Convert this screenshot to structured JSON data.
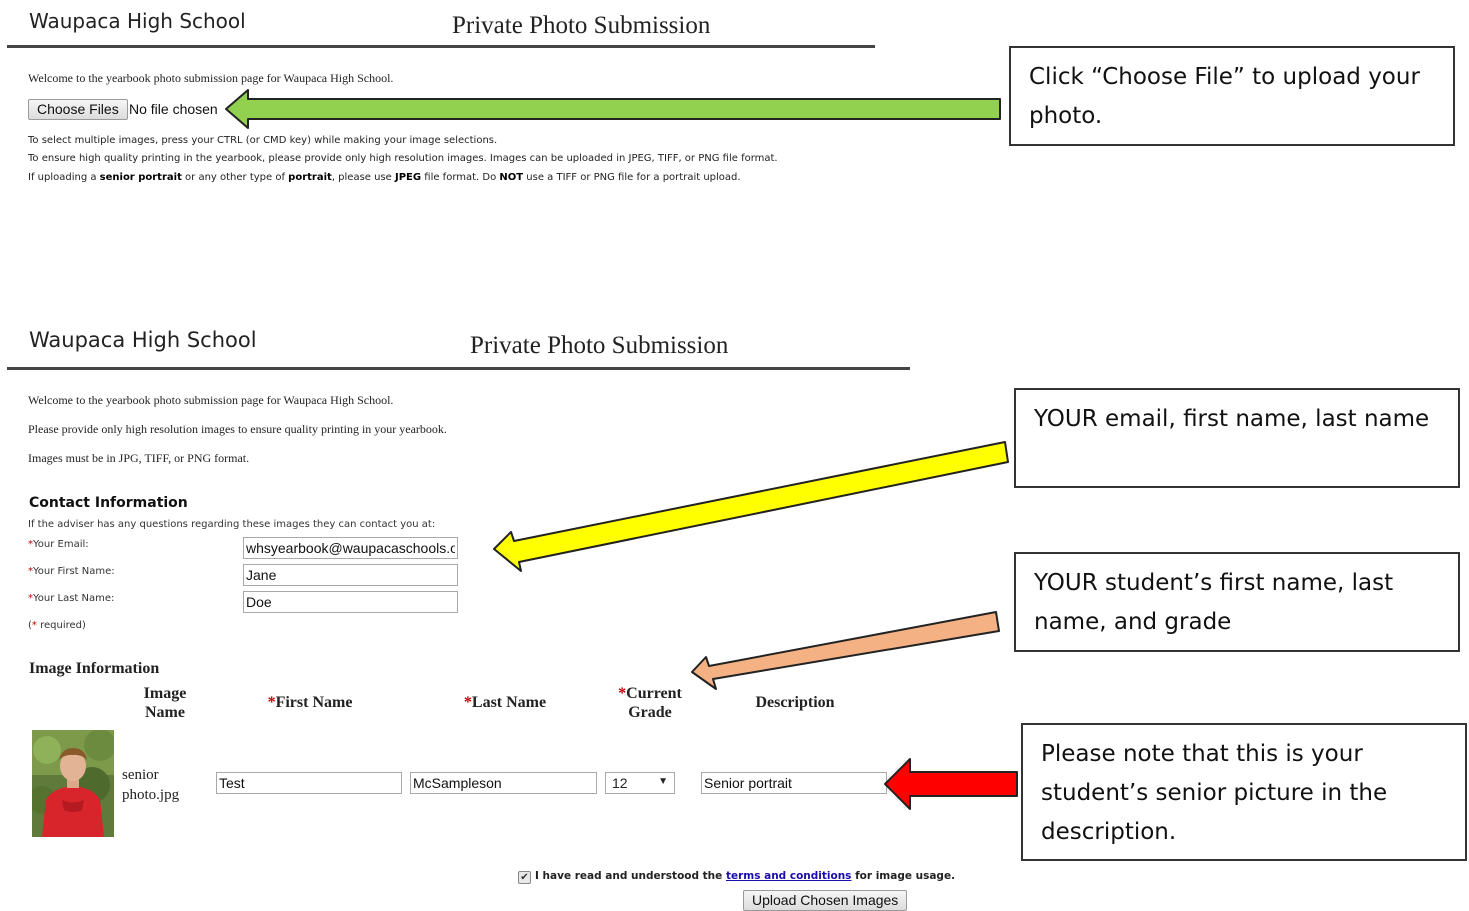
{
  "panel1": {
    "school": "Waupaca High School",
    "title": "Private Photo Submission",
    "welcome": "Welcome to the yearbook photo submission page for Waupaca High School.",
    "choose_button": "Choose Files",
    "no_file": "No file chosen",
    "inst1": "To select multiple images, press your CTRL (or CMD key) while making your image selections.",
    "inst2": "To ensure high quality printing in the yearbook, please provide only high resolution images. Images can be uploaded in JPEG, TIFF, or PNG file format.",
    "inst3": {
      "p1": "If uploading a ",
      "b1": "senior portrait",
      "p2": " or any other type of ",
      "b2": "portrait",
      "p3": ", please use ",
      "b3": "JPEG",
      "p4": " file format. Do ",
      "b4": "NOT",
      "p5": " use a TIFF or PNG file for a portrait upload."
    }
  },
  "panel2": {
    "school": "Waupaca High School",
    "title": "Private Photo Submission",
    "welcome": "Welcome to the yearbook photo submission page for Waupaca High School.",
    "quality": "Please provide only high resolution images to ensure quality printing in your yearbook.",
    "format": "Images must be in JPG, TIFF, or PNG format.",
    "contact_heading": "Contact Information",
    "contact_note": "If the adviser has any questions regarding these images they can contact you at:",
    "email_label": "Your Email:",
    "first_label": "Your First Name:",
    "last_label": "Your Last Name:",
    "email_value": "whsyearbook@waupacaschools.org",
    "first_value": "Jane",
    "last_value": "Doe",
    "required_note": " required)",
    "image_heading": "Image Information",
    "col_image_name_1": "Image",
    "col_image_name_2": "Name",
    "col_first": "First Name",
    "col_last": "Last Name",
    "col_grade_1": "Current",
    "col_grade_2": "Grade",
    "col_desc": "Description",
    "file_name_1": "senior",
    "file_name_2": "photo.jpg",
    "row_first": "Test",
    "row_last": "McSampleson",
    "row_grade": "12",
    "row_desc": "Senior portrait",
    "terms_pre": "I have read and understood the ",
    "terms_link": "terms and conditions",
    "terms_post": " for image usage.",
    "upload_button": "Upload Chosen Images"
  },
  "callouts": {
    "c1": "Click “Choose File” to upload your photo.",
    "c2": "YOUR email, first name, last name",
    "c3": "YOUR student’s first name, last name, and grade",
    "c4": "Please note that this is your student’s senior picture in the description."
  },
  "colors": {
    "arrow_green": "#92d050",
    "arrow_yellow": "#ffff00",
    "arrow_orange": "#f4b183",
    "arrow_red": "#ff0000",
    "required": "#c00000",
    "link": "#1a0dab"
  },
  "icons": [
    "checkbox-checked-icon",
    "dropdown-caret-icon",
    "student-photo-thumbnail"
  ]
}
